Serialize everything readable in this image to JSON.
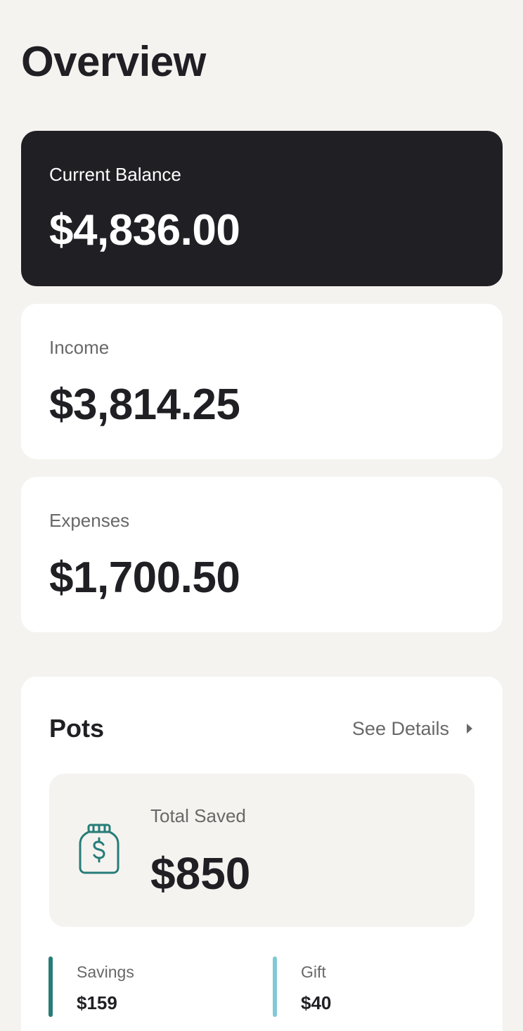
{
  "header": {
    "title": "Overview"
  },
  "summary": {
    "balance": {
      "label": "Current Balance",
      "value": "$4,836.00"
    },
    "income": {
      "label": "Income",
      "value": "$3,814.25"
    },
    "expenses": {
      "label": "Expenses",
      "value": "$1,700.50"
    }
  },
  "pots": {
    "title": "Pots",
    "see_details_label": "See Details",
    "total_saved": {
      "label": "Total Saved",
      "value": "$850",
      "icon": "jar-dollar-icon"
    },
    "items": [
      {
        "name": "Savings",
        "amount": "$159",
        "color": "#277C78"
      },
      {
        "name": "Gift",
        "amount": "$40",
        "color": "#82C9D7"
      }
    ]
  },
  "colors": {
    "background": "#F5F3EF",
    "dark_card": "#201F24",
    "muted_text": "#696868",
    "accent_green": "#277C78"
  }
}
